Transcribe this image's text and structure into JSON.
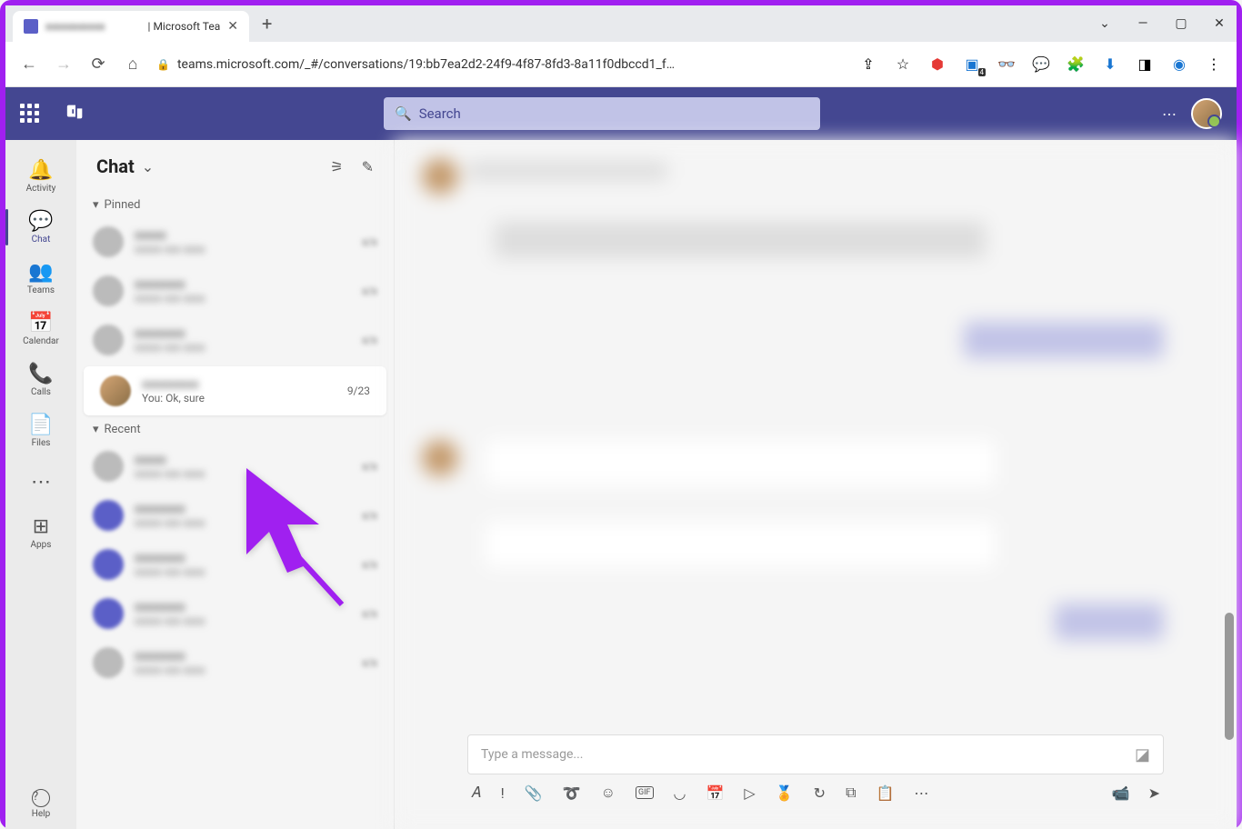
{
  "browser": {
    "tab_title_suffix": " | Microsoft Tea",
    "url": "teams.microsoft.com/_#/conversations/19:bb7ea2d2-24f9-4f87-8fd3-8a11f0dbccd1_f…",
    "extension_badge": "4"
  },
  "teams_header": {
    "search_placeholder": "Search",
    "more": "⋯"
  },
  "rail": {
    "items": [
      {
        "icon": "🔔",
        "label": "Activity"
      },
      {
        "icon": "💬",
        "label": "Chat"
      },
      {
        "icon": "👥",
        "label": "Teams"
      },
      {
        "icon": "📅",
        "label": "Calendar"
      },
      {
        "icon": "📞",
        "label": "Calls"
      },
      {
        "icon": "📄",
        "label": "Files"
      }
    ],
    "more": "⋯",
    "apps": {
      "icon": "⊞",
      "label": "Apps"
    },
    "help": {
      "icon": "?",
      "label": "Help"
    }
  },
  "chat_panel": {
    "title": "Chat",
    "sections": {
      "pinned": "Pinned",
      "recent": "Recent"
    },
    "selected": {
      "name": "",
      "preview": "You: Ok, sure",
      "time": "9/23"
    }
  },
  "compose": {
    "placeholder": "Type a message..."
  }
}
